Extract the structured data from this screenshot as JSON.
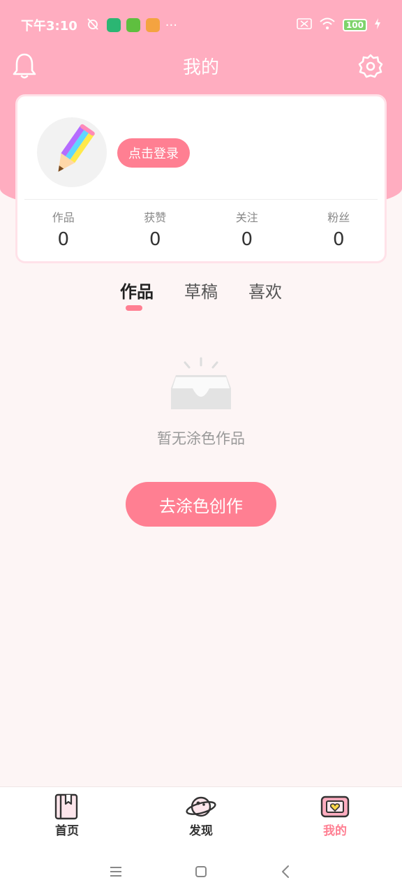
{
  "status_bar": {
    "time": "下午3:10",
    "more": "···",
    "battery": "100"
  },
  "header": {
    "title": "我的",
    "left_icon": "bell-icon",
    "right_icon": "gear-icon"
  },
  "profile": {
    "login_label": "点击登录",
    "stats": [
      {
        "label": "作品",
        "value": "0"
      },
      {
        "label": "获赞",
        "value": "0"
      },
      {
        "label": "关注",
        "value": "0"
      },
      {
        "label": "粉丝",
        "value": "0"
      }
    ]
  },
  "tabs": [
    {
      "label": "作品",
      "active": true
    },
    {
      "label": "草稿",
      "active": false
    },
    {
      "label": "喜欢",
      "active": false
    }
  ],
  "empty_state": {
    "message": "暂无涂色作品",
    "action_label": "去涂色创作"
  },
  "tab_bar": [
    {
      "label": "首页",
      "icon": "bookmark-book-icon"
    },
    {
      "label": "发现",
      "icon": "planet-icon"
    },
    {
      "label": "我的",
      "icon": "heart-frame-icon",
      "active": true
    }
  ],
  "colors": {
    "accent": "#ff7f92",
    "header_pink": "#ffadc0",
    "background": "#fdf5f5"
  }
}
